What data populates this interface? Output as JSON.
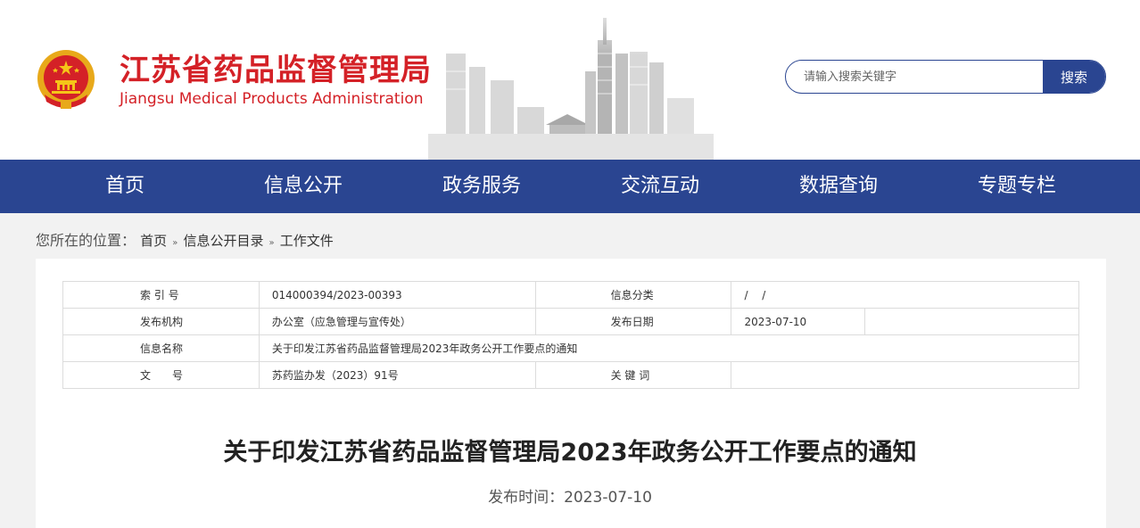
{
  "header": {
    "site_name_cn": "江苏省药品监督管理局",
    "site_name_en": "Jiangsu Medical Products Administration",
    "brand_color": "#d42127",
    "emblem_icon": "national-emblem-icon",
    "skyline_image": "city-skyline-illustration"
  },
  "search": {
    "placeholder": "请输入搜索关键字",
    "value": "",
    "button_label": "搜索"
  },
  "nav": {
    "background": "#2a4591",
    "items": [
      {
        "label": "首页"
      },
      {
        "label": "信息公开"
      },
      {
        "label": "政务服务"
      },
      {
        "label": "交流互动"
      },
      {
        "label": "数据查询"
      },
      {
        "label": "专题专栏"
      }
    ]
  },
  "breadcrumb": {
    "prefix": "您所在的位置：",
    "items": [
      "首页",
      "信息公开目录",
      "工作文件"
    ],
    "separator": "»"
  },
  "info_table": {
    "index_label": "索 引 号",
    "index_value": "014000394/2023-00393",
    "category_label": "信息分类",
    "category_value": "/　 /",
    "publisher_label": "发布机构",
    "publisher_value": "办公室（应急管理与宣传处）",
    "date_label": "发布日期",
    "date_value": "2023-07-10",
    "name_label": "信息名称",
    "name_value": "关于印发江苏省药品监督管理局2023年政务公开工作要点的通知",
    "docno_label": "文　　号",
    "docno_value": "苏药监办发（2023）91号",
    "keywords_label": "关 键 词",
    "keywords_value": ""
  },
  "article": {
    "title": "关于印发江苏省药品监督管理局2023年政务公开工作要点的通知",
    "publish_label": "发布时间：",
    "publish_date": "2023-07-10"
  }
}
